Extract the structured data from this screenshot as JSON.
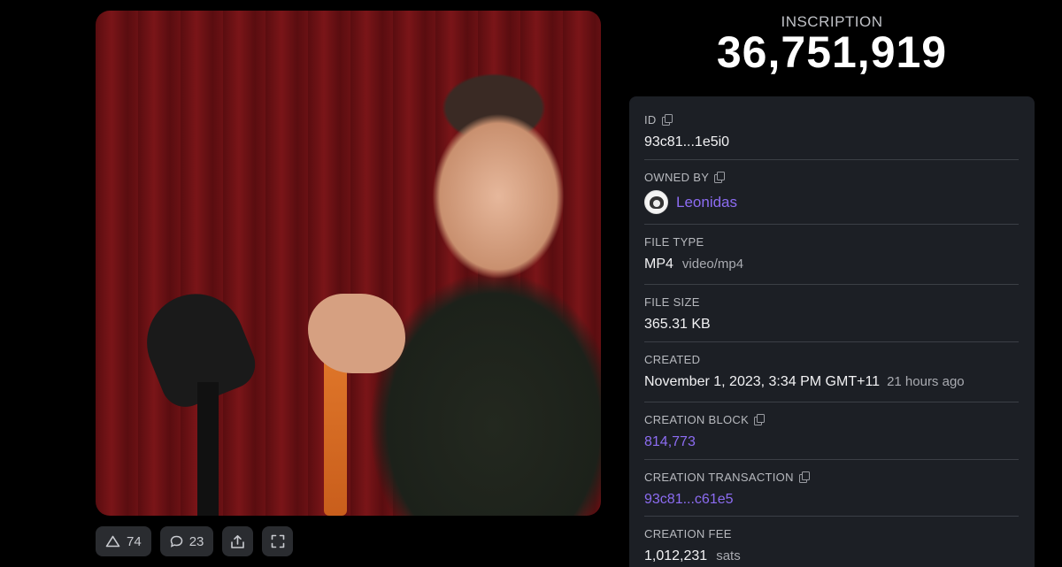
{
  "header": {
    "label": "INSCRIPTION",
    "number": "36,751,919"
  },
  "media": {
    "type": "video-thumbnail"
  },
  "controls": {
    "upvotes": "74",
    "comments": "23"
  },
  "details": {
    "id": {
      "label": "ID",
      "value": "93c81...1e5i0"
    },
    "owned_by": {
      "label": "OWNED BY",
      "value": "Leonidas"
    },
    "file_type": {
      "label": "FILE TYPE",
      "value": "MP4",
      "sub": "video/mp4"
    },
    "file_size": {
      "label": "FILE SIZE",
      "value": "365.31 KB"
    },
    "created": {
      "label": "CREATED",
      "value": "November 1, 2023, 3:34 PM GMT+11",
      "sub": "21 hours ago"
    },
    "creation_block": {
      "label": "CREATION BLOCK",
      "value": "814,773"
    },
    "creation_transaction": {
      "label": "CREATION TRANSACTION",
      "value": "93c81...c61e5"
    },
    "creation_fee": {
      "label": "CREATION FEE",
      "value": "1,012,231",
      "sub": "sats"
    }
  },
  "colors": {
    "background": "#000000",
    "card": "#1c1f25",
    "link": "#8c6cf2"
  }
}
